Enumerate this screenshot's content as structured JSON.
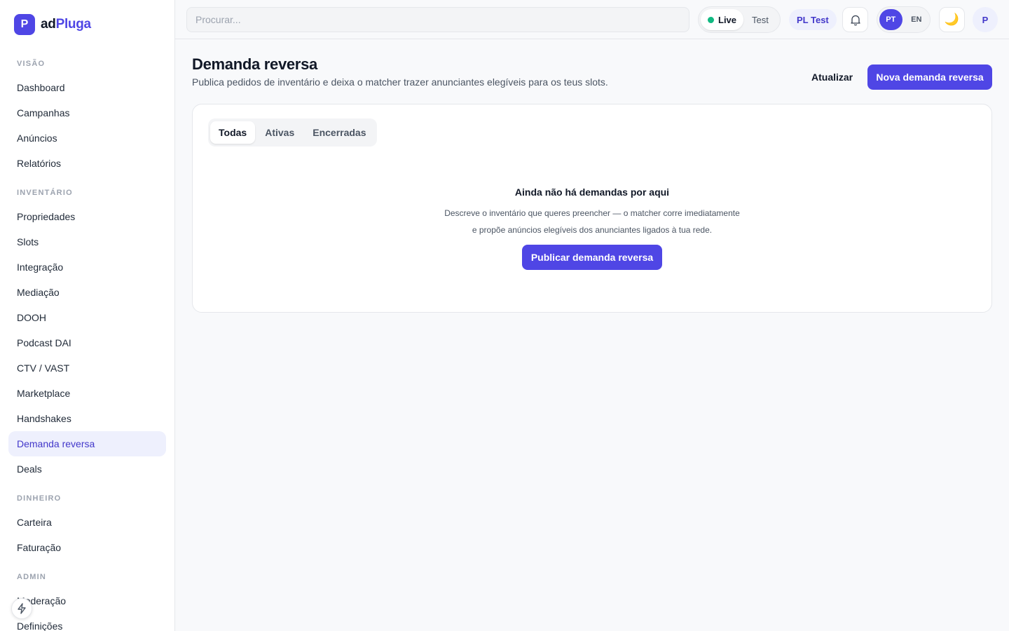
{
  "brand": {
    "logo_letter": "P",
    "name_prefix": "ad",
    "name_accent": "Pluga",
    "accent_color": "#4f46e5"
  },
  "sidebar": {
    "sections": [
      {
        "label": "VISÃO",
        "items": [
          "Dashboard",
          "Campanhas",
          "Anúncios",
          "Relatórios"
        ]
      },
      {
        "label": "INVENTÁRIO",
        "items": [
          "Propriedades",
          "Slots",
          "Integração",
          "Mediação",
          "DOOH",
          "Podcast DAI",
          "CTV / VAST",
          "Marketplace",
          "Handshakes",
          "Demanda reversa",
          "Deals"
        ]
      },
      {
        "label": "DINHEIRO",
        "items": [
          "Carteira",
          "Faturação"
        ]
      },
      {
        "label": "ADMIN",
        "items": [
          "Moderação",
          "Definições"
        ]
      }
    ],
    "active_item": "Demanda reversa"
  },
  "topbar": {
    "search_placeholder": "Procurar...",
    "env": {
      "live": "Live",
      "test": "Test",
      "selected": "Live"
    },
    "account": "PL Test",
    "lang": {
      "pt": "PT",
      "en": "EN",
      "selected": "PT"
    },
    "theme_icon": "🌙",
    "avatar": "P"
  },
  "page": {
    "title": "Demanda reversa",
    "subtitle": "Publica pedidos de inventário e deixa o matcher trazer anunciantes elegíveis para os teus slots.",
    "refresh_label": "Atualizar",
    "new_label": "Nova demanda reversa"
  },
  "tabs": {
    "items": [
      "Todas",
      "Ativas",
      "Encerradas"
    ],
    "selected": "Todas"
  },
  "empty": {
    "title": "Ainda não há demandas por aqui",
    "line1": "Descreve o inventário que queres preencher — o matcher corre imediatamente",
    "line2": "e propõe anúncios elegíveis dos anunciantes ligados à tua rede.",
    "cta": "Publicar demanda reversa"
  }
}
